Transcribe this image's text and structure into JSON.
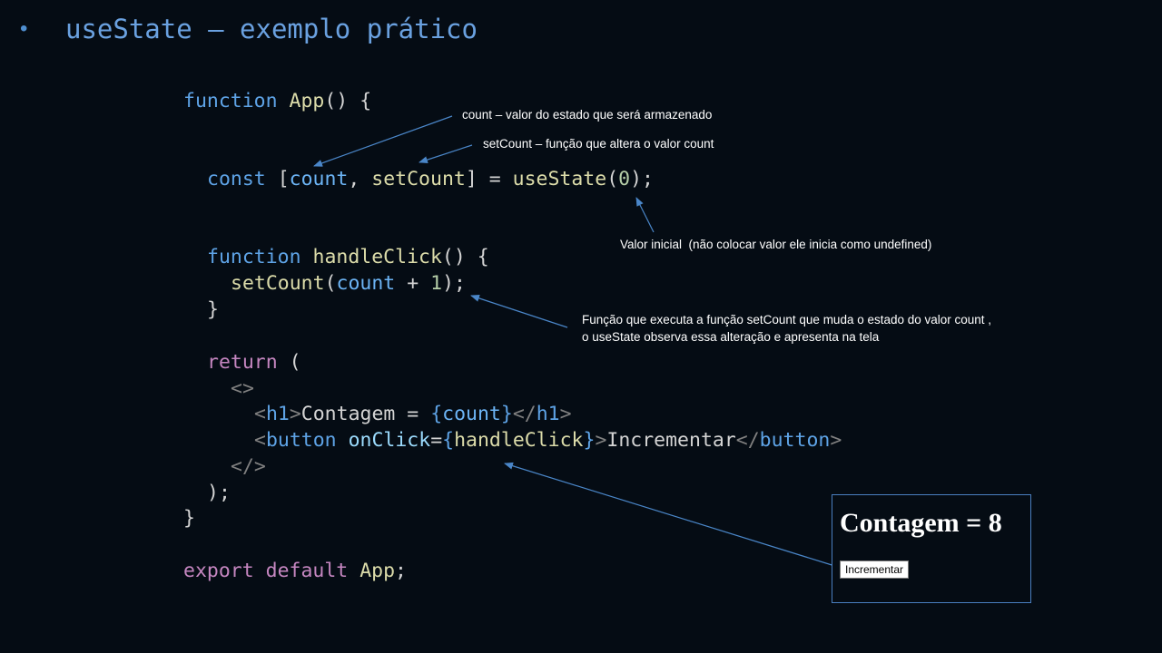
{
  "slide": {
    "bullet": "•",
    "title": "useState – exemplo prático"
  },
  "code": {
    "l1": {
      "kw": "function",
      "name": "App",
      "rest": "() {"
    },
    "l2": {
      "kw": "const",
      "open": "[",
      "count": "count",
      "comma": ",",
      "setCount": "setCount",
      "close": "] =",
      "fn": "useState",
      "p1": "(",
      "num": "0",
      "p2": ");"
    },
    "l3": {
      "kw": "function",
      "name": "handleClick",
      "rest": "() {"
    },
    "l4": {
      "fn": "setCount",
      "p1": "(",
      "var": "count",
      "plus": "+",
      "num": "1",
      "p2": ");"
    },
    "l5": "}",
    "l6": {
      "kw": "return",
      "rest": "("
    },
    "l7": "<>",
    "l8": {
      "lt": "<",
      "tag": "h1",
      "gt": ">",
      "text": "Contagem =",
      "b1": "{",
      "var": "count",
      "b2": "}",
      "lt2": "</",
      "tag2": "h1",
      "gt2": ">"
    },
    "l9": {
      "lt": "<",
      "tag": "button",
      "attr": "onClick",
      "eq": "=",
      "b1": "{",
      "fn": "handleClick",
      "b2": "}",
      "gt": ">",
      "text": "Incrementar",
      "lt2": "</",
      "tag2": "button",
      "gt2": ">"
    },
    "l10": "</>",
    "l11": ");",
    "l12": "}",
    "l13": {
      "export": "export",
      "default": "default",
      "name": "App",
      "semi": ";"
    }
  },
  "annotations": {
    "count": "count – valor do estado que será armazenado",
    "setCount": "setCount – função que altera o valor count",
    "initial": "Valor inicial  (não colocar valor ele inicia como undefined)",
    "func_line1": "Função que executa a função setCount que muda o estado do valor count ,",
    "func_line2": "o useState observa essa alteração e apresenta na tela"
  },
  "preview": {
    "heading": "Contagem = 8",
    "button": "Incrementar"
  }
}
